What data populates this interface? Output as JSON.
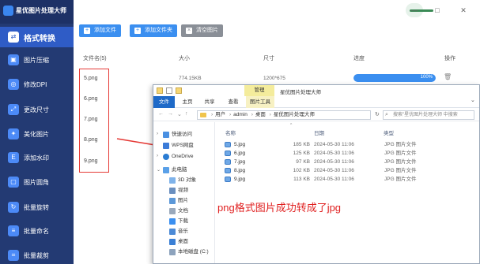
{
  "app": {
    "title": "星优图片处理大师",
    "window_controls": {
      "minimize": "—",
      "maximize": "□",
      "close": "✕"
    }
  },
  "sidebar": {
    "items": [
      {
        "label": "格式转换",
        "icon": "convert-icon",
        "active": true
      },
      {
        "label": "图片压缩",
        "icon": "compress-icon"
      },
      {
        "label": "修改DPI",
        "icon": "dpi-icon"
      },
      {
        "label": "更改尺寸",
        "icon": "resize-icon"
      },
      {
        "label": "美化图片",
        "icon": "beautify-icon"
      },
      {
        "label": "添加水印",
        "icon": "watermark-icon"
      },
      {
        "label": "图片圆角",
        "icon": "round-corner-icon"
      },
      {
        "label": "批量旋转",
        "icon": "rotate-icon"
      },
      {
        "label": "批量命名",
        "icon": "rename-icon"
      },
      {
        "label": "批量裁剪",
        "icon": "crop-icon"
      }
    ]
  },
  "toolbar": {
    "add_file": "添加文件",
    "add_folder": "添加文件夹",
    "clear": "清空图片"
  },
  "table": {
    "headers": {
      "name": "文件名(5)",
      "size": "大小",
      "dimension": "尺寸",
      "progress": "进度",
      "action": "操作"
    },
    "first_row": {
      "size": "774.15KB",
      "dimension": "1200*675",
      "progress_label": "100%",
      "progress": 1.0
    },
    "files": [
      "5.png",
      "6.png",
      "7.png",
      "8.png",
      "9.png"
    ]
  },
  "explorer": {
    "title": "星优图片处理大师",
    "context_tab": "管理",
    "ribbon_tabs": [
      "文件",
      "主页",
      "共享",
      "查看",
      "图片工具"
    ],
    "address": [
      "用户",
      "admin",
      "桌面",
      "星优图片处理大师"
    ],
    "search_placeholder": "搜索\"星优图片处理大师 中搜索",
    "columns": {
      "name": "名称",
      "date": "日期",
      "type": "类型"
    },
    "nav": {
      "quick_access": "快速访问",
      "wps": "WPS网盘",
      "onedrive": "OneDrive",
      "this_pc": "此电脑",
      "folders": [
        "3D 对象",
        "视频",
        "图片",
        "文档",
        "下载",
        "音乐",
        "桌面",
        "本地磁盘 (C:)"
      ]
    },
    "files": [
      {
        "name": "5.jpg",
        "size": "185 KB",
        "date": "2024-05-30 11:06",
        "type": "JPG 图片文件"
      },
      {
        "name": "6.jpg",
        "size": "125 KB",
        "date": "2024-05-30 11:06",
        "type": "JPG 图片文件"
      },
      {
        "name": "7.jpg",
        "size": "97 KB",
        "date": "2024-05-30 11:06",
        "type": "JPG 图片文件"
      },
      {
        "name": "8.jpg",
        "size": "102 KB",
        "date": "2024-05-30 11:06",
        "type": "JPG 图片文件"
      },
      {
        "name": "9.jpg",
        "size": "113 KB",
        "date": "2024-05-30 11:06",
        "type": "JPG 图片文件"
      }
    ]
  },
  "annotation": {
    "caption": "png格式图片成功转成了jpg"
  },
  "colors": {
    "sidebar": "#233a73",
    "accent": "#3b8ff0",
    "annotation": "#e53935"
  }
}
